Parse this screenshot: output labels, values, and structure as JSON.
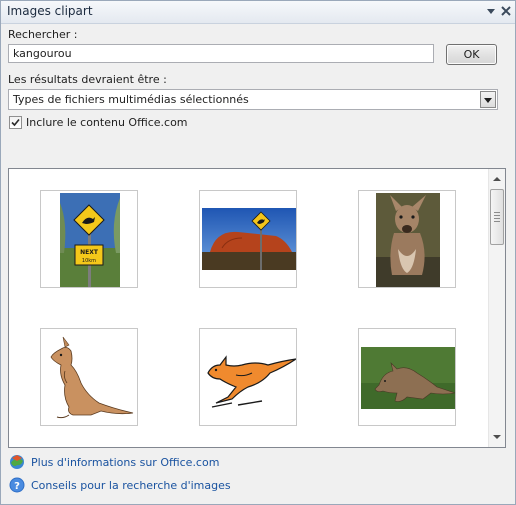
{
  "pane": {
    "title": "Images clipart"
  },
  "search": {
    "label": "Rechercher :",
    "value": "kangourou",
    "button": "OK"
  },
  "results_filter": {
    "label": "Les résultats devraient être :",
    "selected": "Types de fichiers multimédias sélectionnés"
  },
  "include_office": {
    "label": "Inclure le contenu Office.com",
    "checked": true
  },
  "results": {
    "items": [
      {
        "icon": "kangaroo-road-sign-photo",
        "sign_text": "NEXT",
        "sign_subtext": "10km"
      },
      {
        "icon": "uluru-kangaroo-sign-photo"
      },
      {
        "icon": "kangaroo-photo"
      },
      {
        "icon": "kangaroo-drawing"
      },
      {
        "icon": "jumping-kangaroo-drawing"
      },
      {
        "icon": "kangaroo-grass-photo"
      }
    ]
  },
  "links": [
    {
      "label": "Plus d'informations sur Office.com",
      "icon": "office-globe-icon"
    },
    {
      "label": "Conseils pour la recherche d'images",
      "icon": "help-icon"
    }
  ],
  "colors": {
    "link": "#1a53a0",
    "title": "#1c2b3f",
    "pane_bg": "#f0f0f0"
  }
}
